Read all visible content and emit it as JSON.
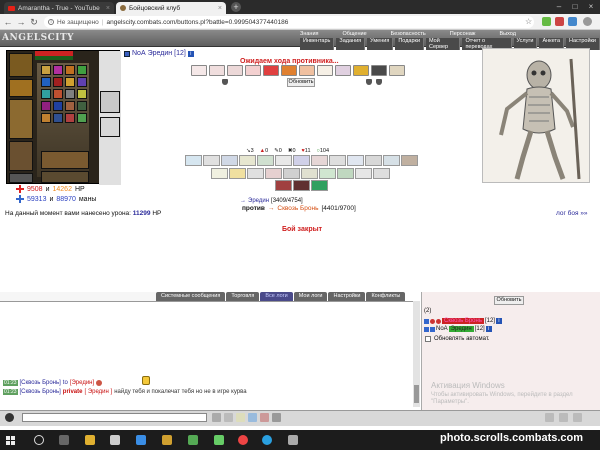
{
  "browser": {
    "tabs": [
      {
        "title": "Amarantha - True - YouTube"
      },
      {
        "title": "Бойцовский клуб"
      }
    ],
    "insecure_label": "Не защищено",
    "url": "angelscity.combats.com/buttons.pl?battle=0.999504377440186"
  },
  "site": {
    "logo": "ANGELSCITY",
    "topnav_row1": [
      "Знания",
      "Общение",
      "Безопасность",
      "Персонаж",
      "Выход"
    ],
    "topnav_row2": [
      "Инвентарь",
      "Задания",
      "Умения",
      "Подарки",
      "Мой Сервер",
      "Отчет о переводах",
      "Услуги",
      "Анкета",
      "Настройки"
    ]
  },
  "character": {
    "flag": "NoA",
    "name": "Эредин",
    "level": "[12]",
    "hp_current": "9508",
    "hp_max": "14262",
    "hp_label": "HP",
    "mana_current": "59313",
    "mana_max": "88970",
    "mana_label": "маны",
    "and": "и"
  },
  "battle": {
    "waiting": "Ожидаем хода противника...",
    "refresh": "Обновить",
    "stats": [
      "3",
      "0",
      "0",
      "0",
      "11",
      "104"
    ],
    "damage_label": "На данный момент вами нанесено урона:",
    "damage_value": "11299",
    "damage_unit": "HP",
    "log_link": "лог боя »»",
    "player_name": "Эредин",
    "player_hp": "[3409/4754]",
    "vs": "против",
    "enemy_name": "Сквозь Бронь",
    "enemy_hp": "[4401/9700]",
    "closed": "Бой закрыт"
  },
  "chat": {
    "tabs": [
      "Системные сообщения",
      "Торговля",
      "Все логи",
      "Мои логи",
      "Настройки",
      "Конфликты"
    ],
    "active_tab": 2,
    "lines": [
      {
        "time": "01:23",
        "sender": "[Сквозь Бронь]",
        "to": "to",
        "target": "[Эредин]",
        "text": ""
      },
      {
        "time": "01:23",
        "sender": "[Сквозь Бронь]",
        "to": "private",
        "target": "[ Эредин ]",
        "text": "найду тебя и покалечат тебя но не в игре курва"
      }
    ]
  },
  "users": {
    "refresh": "Обновить",
    "count": "(2)",
    "list": [
      {
        "name": "Сквозь Бронь",
        "level": "[12]"
      },
      {
        "flag": "NoA",
        "name": "Эредин",
        "level": "[12]"
      }
    ],
    "auto_refresh": "Обновлять автомат."
  },
  "windows_notice": {
    "title": "Активация Windows",
    "text": "Чтобы активировать Windows, перейдите в раздел \"Параметры\"."
  },
  "watermark": "photo.scrolls.combats.com"
}
